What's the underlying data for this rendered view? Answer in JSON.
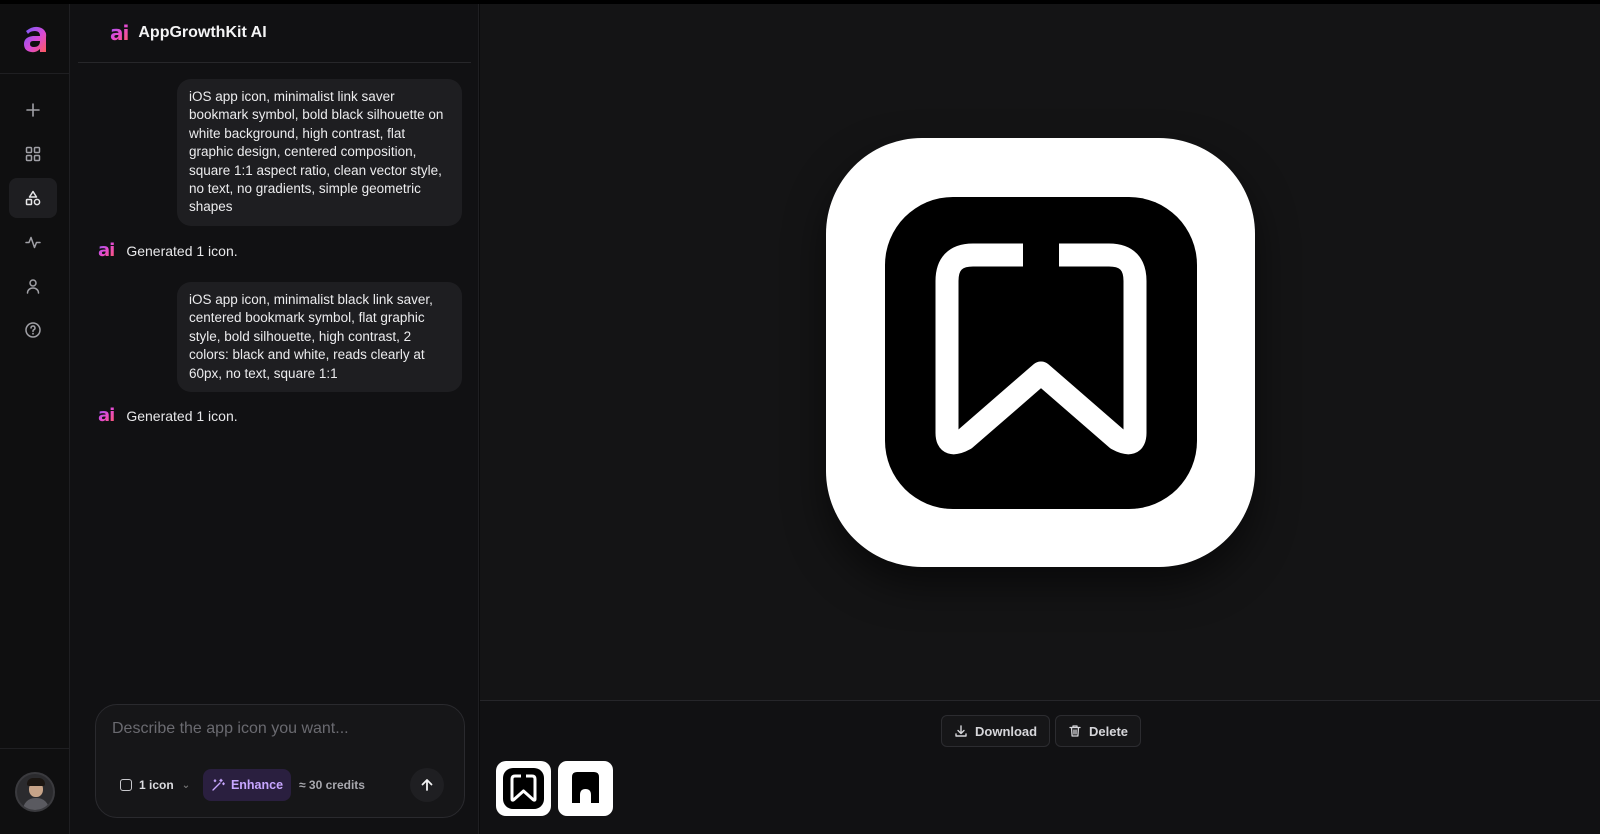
{
  "app": {
    "name": "AppGrowthKit AI",
    "logo_glyph": "ai",
    "rail_logo_glyph": "a"
  },
  "rail": {
    "items": [
      {
        "name": "new",
        "icon": "plus-icon"
      },
      {
        "name": "apps",
        "icon": "grid-icon"
      },
      {
        "name": "icons",
        "icon": "shapes-icon",
        "active": true
      },
      {
        "name": "analytics",
        "icon": "activity-icon"
      },
      {
        "name": "account",
        "icon": "user-icon"
      },
      {
        "name": "help",
        "icon": "help-circle-icon"
      }
    ]
  },
  "chat": {
    "messages": [
      {
        "role": "user",
        "text": "iOS app icon, minimalist link saver bookmark symbol, bold black silhouette on white background, high contrast, flat graphic design, centered composition, square 1:1 aspect ratio, clean vector style, no text, no gradients, simple geometric shapes"
      },
      {
        "role": "assistant",
        "text": "Generated 1 icon."
      },
      {
        "role": "user",
        "text": "iOS app icon, minimalist black link saver, centered bookmark symbol, flat graphic style, bold silhouette, high contrast, 2 colors: black and white, reads clearly at 60px, no text, square 1:1"
      },
      {
        "role": "assistant",
        "text": "Generated 1 icon."
      }
    ]
  },
  "composer": {
    "placeholder": "Describe the app icon you want...",
    "count_label": "1 icon",
    "enhance_label": "Enhance",
    "credits_label": "≈ 30 credits"
  },
  "preview": {
    "actions": {
      "download_label": "Download",
      "delete_label": "Delete"
    }
  },
  "colors": {
    "accent": "#c7a6ff",
    "background": "#0b0b0c"
  }
}
